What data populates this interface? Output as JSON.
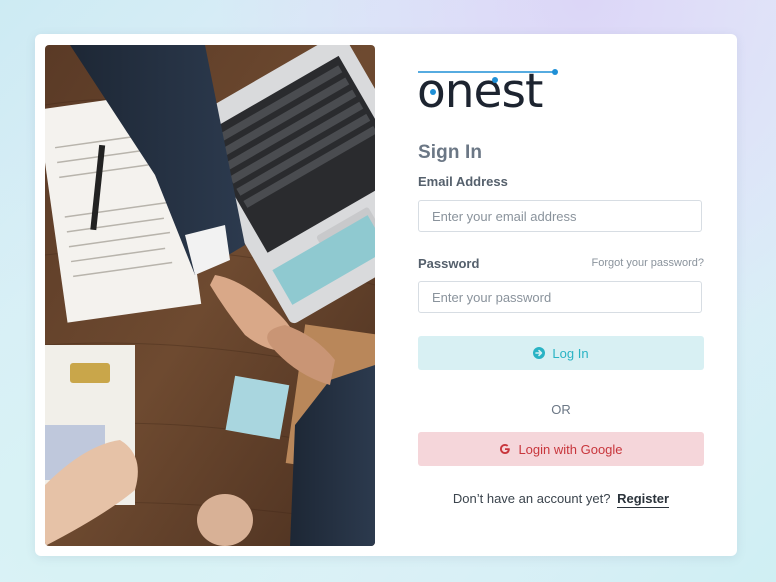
{
  "brand": {
    "logo_text": "onest"
  },
  "signin": {
    "title": "Sign In",
    "email_label": "Email Address",
    "email_placeholder": "Enter your email address",
    "email_value": "",
    "password_label": "Password",
    "password_placeholder": "Enter your password",
    "password_value": "",
    "forgot_label": "Forgot your password?",
    "login_label": "Log In",
    "or_label": "OR",
    "google_label": "Login with Google",
    "no_account_text": "Don’t have an account yet?",
    "register_label": "Register"
  },
  "icons": {
    "login_icon": "arrow-right-circle-icon",
    "google_icon": "google-g-icon"
  },
  "colors": {
    "accent": "#29b3c4",
    "login_bg": "#d8f0f3",
    "google_text": "#c8363c",
    "google_bg": "#f5d6da",
    "logo_dot": "#1f8fd6"
  }
}
